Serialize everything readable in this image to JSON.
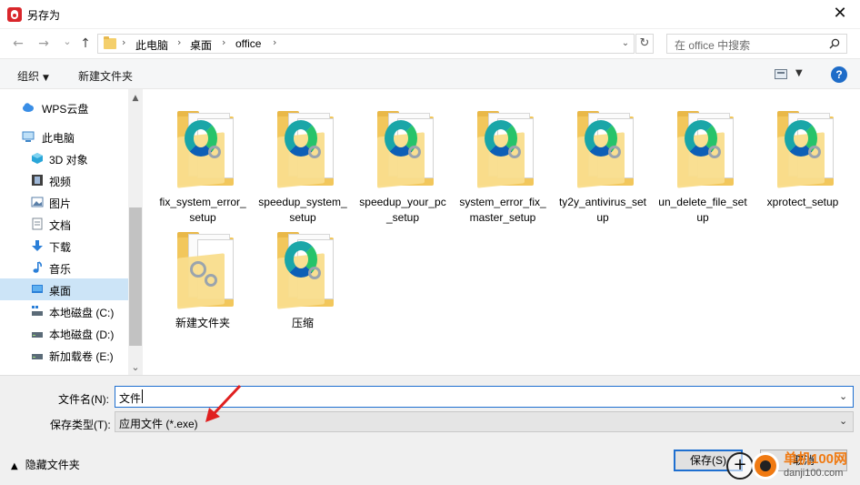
{
  "window": {
    "title": "另存为",
    "close_glyph": "✕"
  },
  "nav": {
    "back_glyph": "←",
    "forward_glyph": "→",
    "recent_glyph": "⌄",
    "up_glyph": "↑",
    "breadcrumb": [
      "此电脑",
      "桌面",
      "office"
    ],
    "sep_glyph": "›",
    "dropdown_glyph": "⌄",
    "refresh_glyph": "↻",
    "search_placeholder": "在 office 中搜索"
  },
  "toolbar": {
    "organize_label": "组织",
    "organize_caret": "▼",
    "new_folder_label": "新建文件夹",
    "view_caret": "▼",
    "help_label": "?"
  },
  "sidebar": {
    "scroll_up": "▲",
    "scroll_down": "⌄",
    "items": [
      {
        "label": "WPS云盘",
        "icon": "cloud-icon",
        "color": "#3a8ee6"
      },
      {
        "label": "此电脑",
        "icon": "computer-icon",
        "color": "#3f86c9"
      },
      {
        "label": "3D 对象",
        "icon": "cube-icon",
        "color": "#2aa6d8"
      },
      {
        "label": "视频",
        "icon": "film-icon",
        "color": "#404040"
      },
      {
        "label": "图片",
        "icon": "picture-icon",
        "color": "#5a7fa8"
      },
      {
        "label": "文档",
        "icon": "document-icon",
        "color": "#7d8a96"
      },
      {
        "label": "下载",
        "icon": "download-icon",
        "color": "#2a7fd8"
      },
      {
        "label": "音乐",
        "icon": "music-icon",
        "color": "#2a7fd8"
      },
      {
        "label": "桌面",
        "icon": "desktop-icon",
        "color": "#2a7fd8"
      },
      {
        "label": "本地磁盘 (C:)",
        "icon": "drive-c-icon",
        "color": "#5b6b78"
      },
      {
        "label": "本地磁盘 (D:)",
        "icon": "drive-icon",
        "color": "#5b6b78"
      },
      {
        "label": "新加载卷 (E:)",
        "icon": "drive-icon",
        "color": "#5b6b78"
      }
    ],
    "selected_index": 8
  },
  "files": [
    {
      "label": "fix_system_error_setup",
      "type": "edge-folder"
    },
    {
      "label": "speedup_system_setup",
      "type": "edge-folder"
    },
    {
      "label": "speedup_your_pc_setup",
      "type": "edge-folder"
    },
    {
      "label": "system_error_fix_master_setup",
      "type": "edge-folder"
    },
    {
      "label": "ty2y_antivirus_setup",
      "type": "edge-folder"
    },
    {
      "label": "un_delete_file_setup",
      "type": "edge-folder"
    },
    {
      "label": "xprotect_setup",
      "type": "edge-folder"
    },
    {
      "label": "新建文件夹",
      "type": "gear-folder"
    },
    {
      "label": "压缩",
      "type": "edge-folder"
    }
  ],
  "form": {
    "filename_label": "文件名(N):",
    "filename_value": "文件",
    "filetype_label": "保存类型(T):",
    "filetype_value": "应用文件 (*.exe)",
    "dropdown_glyph": "⌄",
    "hide_folders_chevron": "▲",
    "hide_folders_label": "隐藏文件夹",
    "save_label": "保存(S)",
    "cancel_label": "取消"
  },
  "watermark": {
    "brand": "单机100网",
    "url": "danji100.com",
    "plus_glyph": "+"
  },
  "colors": {
    "accent": "#1e6fd0",
    "selected": "#cce4f7",
    "annotation_arrow": "#e02020"
  }
}
